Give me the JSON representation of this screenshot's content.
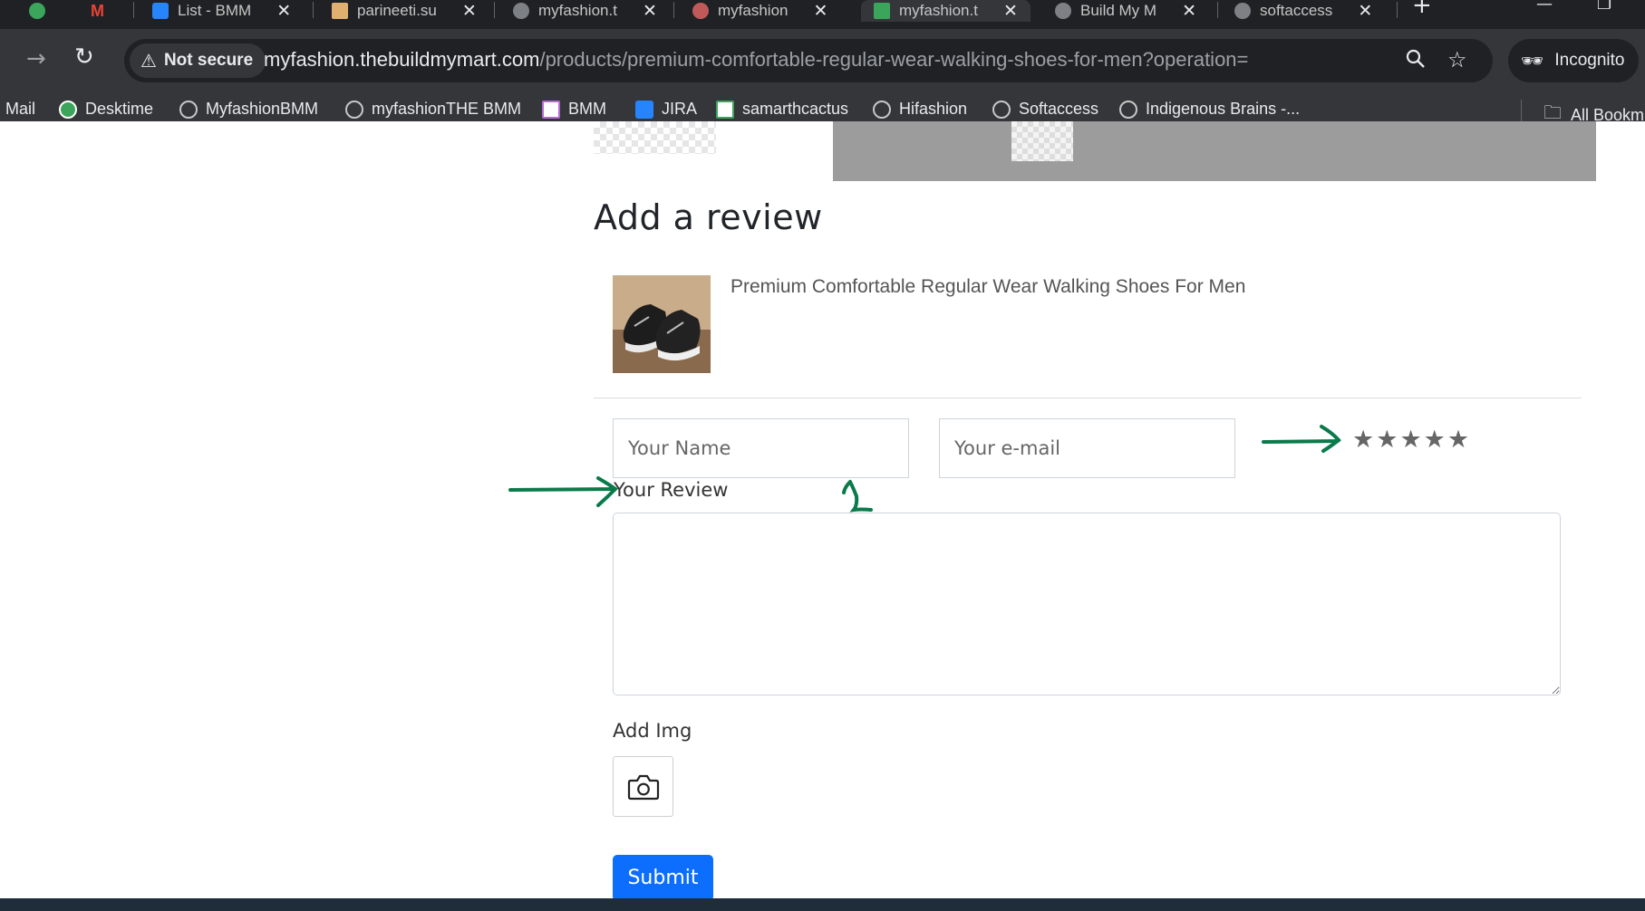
{
  "browser": {
    "tabs": [
      {
        "title": "List - BMM"
      },
      {
        "title": "parineeti.su"
      },
      {
        "title": "myfashion.t"
      },
      {
        "title": "myfashion"
      },
      {
        "title": "myfashion.t",
        "active": true
      },
      {
        "title": "Build My M"
      },
      {
        "title": "softaccess"
      }
    ],
    "new_tab_label": "+",
    "security_chip": "Not secure",
    "url_host": "myfashion.thebuildmymart.com",
    "url_path": "/products/premium-comfortable-regular-wear-walking-shoes-for-men?operation=",
    "incognito_label": "Incognito",
    "bookmarks": [
      "Mail",
      "Desktime",
      "MyfashionBMM",
      "myfashionTHE BMM",
      "BMM",
      "JIRA",
      "samarthcactus",
      "Hifashion",
      "Softaccess",
      "Indigenous Brains -..."
    ],
    "all_bookmarks_label": "All Bookm"
  },
  "review_form": {
    "heading": "Add a review",
    "product_name": "Premium Comfortable Regular Wear Walking Shoes For Men",
    "name_placeholder": "Your Name",
    "email_placeholder": "Your e-mail",
    "rating_stars": [
      "★",
      "★",
      "★",
      "★",
      "★"
    ],
    "review_label": "Your Review",
    "add_img_label": "Add Img",
    "submit_label": "Submit"
  },
  "colors": {
    "annotation": "#0a7a4a",
    "submit_bg": "#0d6efd"
  }
}
